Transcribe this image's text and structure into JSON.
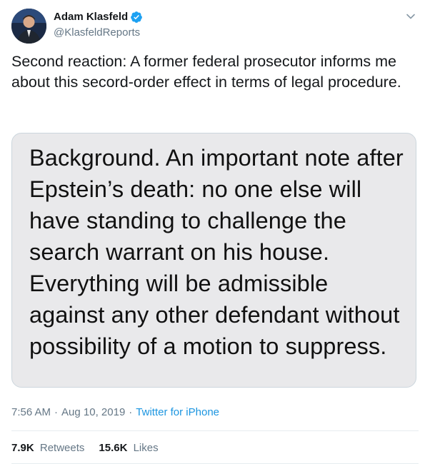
{
  "author": {
    "display_name": "Adam Klasfeld",
    "handle": "@KlasfeldReports",
    "verified": true,
    "avatar_icon": "avatar-photo"
  },
  "tweet": {
    "text": "Second reaction: A former federal prosecutor informs me about this secord-order effect in terms of legal procedure."
  },
  "media": {
    "text": "Background. An important note after Epstein’s death: no one else will have standing to challenge the search warrant on his house. Everything will be admissible against any other defendant without possibility of a motion to suppress."
  },
  "meta": {
    "time": "7:56 AM",
    "separator": "·",
    "date": "Aug 10, 2019",
    "source": "Twitter for iPhone"
  },
  "stats": {
    "retweets_count": "7.9K",
    "retweets_label": "Retweets",
    "likes_count": "15.6K",
    "likes_label": "Likes"
  },
  "colors": {
    "accent": "#1da1f2",
    "link": "#1b95e0",
    "secondary_text": "#657786",
    "media_background": "#e9e9eb"
  },
  "icons": [
    "verified-badge-icon",
    "chevron-down-icon"
  ]
}
